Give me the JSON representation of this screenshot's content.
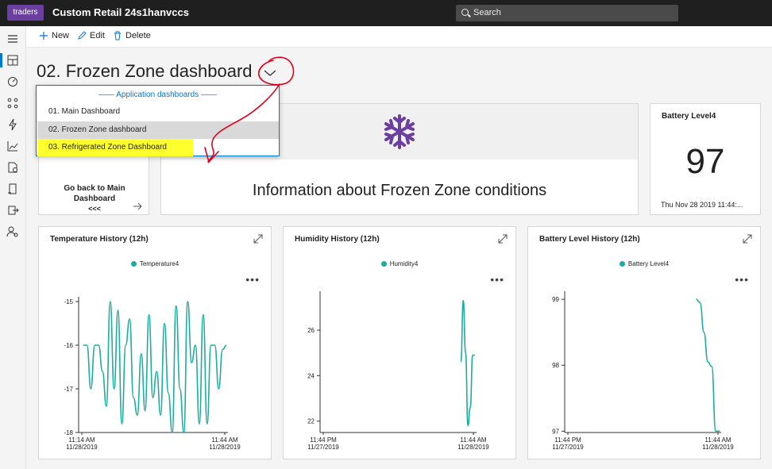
{
  "header": {
    "logo_text": "traders",
    "app_title": "Custom Retail 24s1hanvccs",
    "search_placeholder": "Search"
  },
  "toolbar": {
    "new_label": "New",
    "edit_label": "Edit",
    "delete_label": "Delete"
  },
  "rail": {
    "icons": [
      "menu-icon",
      "dashboard-icon",
      "devices-icon",
      "device-groups-icon",
      "rules-icon",
      "analytics-icon",
      "jobs-icon",
      "templates-icon",
      "data-export-icon",
      "administration-icon"
    ]
  },
  "page": {
    "title": "02. Frozen Zone dashboard"
  },
  "dropdown": {
    "header": "—— Application dashboards ——",
    "items": [
      {
        "label": "01. Main Dashboard"
      },
      {
        "label": "02. Frozen Zone dashboard"
      },
      {
        "label": "03. Refrigerated Zone Dashboard"
      }
    ]
  },
  "tiles": {
    "go_back": {
      "label": "Go back to Main Dashboard",
      "arrows": "<<<"
    },
    "info": {
      "text": "Information about Frozen Zone conditions"
    },
    "battery": {
      "title": "Battery Level4",
      "value": "97",
      "timestamp": "Thu Nov 28 2019 11:44:..."
    }
  },
  "colors": {
    "accent": "#0078d4",
    "series": "#1aada0",
    "snowflake": "#6b3fa0",
    "annotation_red": "#e0001b",
    "highlight": "#ffff2e"
  },
  "chart_data": [
    {
      "type": "line",
      "title": "Temperature History (12h)",
      "series": [
        {
          "name": "Temperature4",
          "values": [
            -16.0,
            -16.0,
            -17.0,
            -16.0,
            -16.0,
            -16.6,
            -17.4,
            -15.0,
            -17.0,
            -15.2,
            -17.8,
            -16.0,
            -15.4,
            -17.2,
            -17.6,
            -16.2,
            -17.5,
            -15.3,
            -17.2,
            -16.6,
            -17.6,
            -15.5,
            -17.1,
            -18.0,
            -15.1,
            -17.0,
            -18.0,
            -15.0,
            -16.4,
            -16.0,
            -17.8,
            -15.3,
            -17.8,
            -16.0,
            -16.0,
            -17.0,
            -16.1,
            -16.0
          ]
        }
      ],
      "x": [
        "11:14 AM\n11/28/2019",
        "11:44 AM\n11/28/2019"
      ],
      "xlabel": "",
      "ylabel": "",
      "yticks": [
        -15,
        -16,
        -17,
        -18
      ],
      "ylim": [
        -18,
        -15
      ]
    },
    {
      "type": "line",
      "title": "Humidity History (12h)",
      "series": [
        {
          "name": "Humidity4",
          "values": [
            24.6,
            27.3,
            25.0,
            21.8,
            22.6,
            24.9,
            24.9
          ]
        }
      ],
      "x": [
        "11:44 PM\n11/27/2019",
        "11:44 AM\n11/28/2019"
      ],
      "xlabel": "",
      "ylabel": "",
      "yticks": [
        22,
        24,
        26
      ],
      "ylim": [
        21.5,
        27.5
      ]
    },
    {
      "type": "line",
      "title": "Battery Level History (12h)",
      "series": [
        {
          "name": "Battery Level4",
          "values": [
            99.0,
            98.95,
            98.5,
            98.05,
            97.98,
            97.0,
            97.0
          ]
        }
      ],
      "x": [
        "11:44 PM\n11/27/2019",
        "11:44 AM\n11/28/2019"
      ],
      "xlabel": "",
      "ylabel": "",
      "yticks": [
        99,
        98,
        97
      ],
      "ylim": [
        96.98,
        99.05
      ]
    }
  ]
}
